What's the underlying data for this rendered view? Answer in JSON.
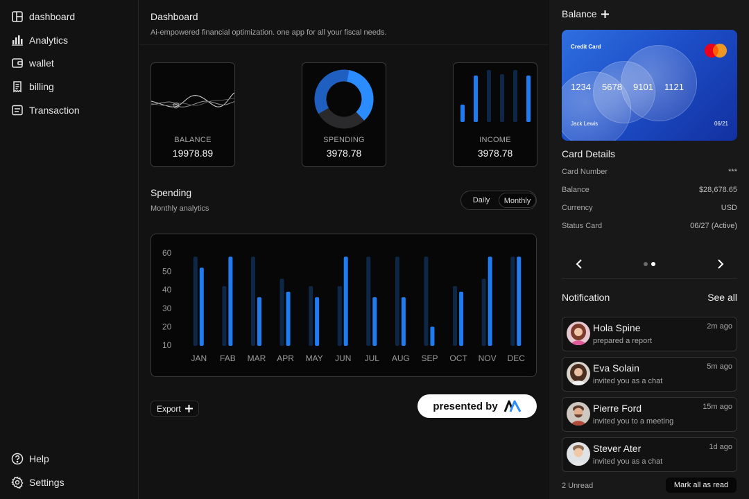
{
  "sidebar": {
    "items": [
      {
        "label": "dashboard",
        "icon": "layout-icon"
      },
      {
        "label": "Analytics",
        "icon": "bar-chart-icon"
      },
      {
        "label": "wallet",
        "icon": "wallet-icon"
      },
      {
        "label": "billing",
        "icon": "receipt-icon"
      },
      {
        "label": "Transaction",
        "icon": "list-icon"
      }
    ],
    "bottom": [
      {
        "label": "Help",
        "icon": "help-icon"
      },
      {
        "label": "Settings",
        "icon": "gear-icon"
      }
    ]
  },
  "header": {
    "title": "Dashboard",
    "subtitle": "Ai-empowered financial optimization. one app for all your fiscal needs."
  },
  "stats": [
    {
      "label": "BALANCE",
      "value": "19978.89"
    },
    {
      "label": "SPENDING",
      "value": "3978.78"
    },
    {
      "label": "INCOME",
      "value": "3978.78"
    }
  ],
  "spending": {
    "title": "Spending",
    "subtitle": "Monthly analytics",
    "toggle": {
      "daily": "Daily",
      "monthly": "Monthly",
      "selected": "Monthly"
    }
  },
  "chart_data": {
    "type": "bar",
    "categories": [
      "JAN",
      "FAB",
      "MAR",
      "APR",
      "MAY",
      "JUN",
      "JUL",
      "AUG",
      "SEP",
      "OCT",
      "NOV",
      "DEC"
    ],
    "series": [
      {
        "values": [
          58,
          42,
          58,
          46,
          42,
          42,
          58,
          58,
          58,
          42,
          46,
          58
        ],
        "color": "#0f2747"
      },
      {
        "values": [
          52,
          58,
          36,
          39,
          36,
          58,
          36,
          36,
          20,
          39,
          58,
          58
        ],
        "color": "#1f7cf0"
      }
    ],
    "yticks": [
      "60",
      "50",
      "40",
      "30",
      "20",
      "10"
    ],
    "ylim": [
      10,
      60
    ],
    "grid": false
  },
  "actions": {
    "export": "Export",
    "presented_by": "presented by"
  },
  "balance_panel": {
    "title": "Balance",
    "card": {
      "label": "Credit Card",
      "number_groups": [
        "1234",
        "5678",
        "9101",
        "1121"
      ],
      "holder": "Jack Lewis",
      "expiry": "06/21"
    },
    "details_title": "Card Details",
    "details": [
      {
        "key": "Card Number",
        "value": "***"
      },
      {
        "key": "Balance",
        "value": "$28,678.65"
      },
      {
        "key": "Currency",
        "value": "USD"
      },
      {
        "key": "Status Card",
        "value": "06/27 (Active)"
      }
    ]
  },
  "notifications": {
    "title": "Notification",
    "see_all": "See all",
    "items": [
      {
        "name": "Hola Spine",
        "message": "prepared a report",
        "time": "2m ago"
      },
      {
        "name": "Eva Solain",
        "message": "invited you as a chat",
        "time": "5m ago"
      },
      {
        "name": "Pierre Ford",
        "message": "invited you to a meeting",
        "time": "15m ago"
      },
      {
        "name": "Stever Ater",
        "message": "invited you as a chat",
        "time": "1d ago"
      }
    ],
    "unread": "2 Unread",
    "mark_all": "Mark all as read"
  },
  "colors": {
    "accent": "#1f7cf0",
    "accent_dark": "#0f2747",
    "background": "#121213",
    "card_blue": "#1d4fc9"
  }
}
